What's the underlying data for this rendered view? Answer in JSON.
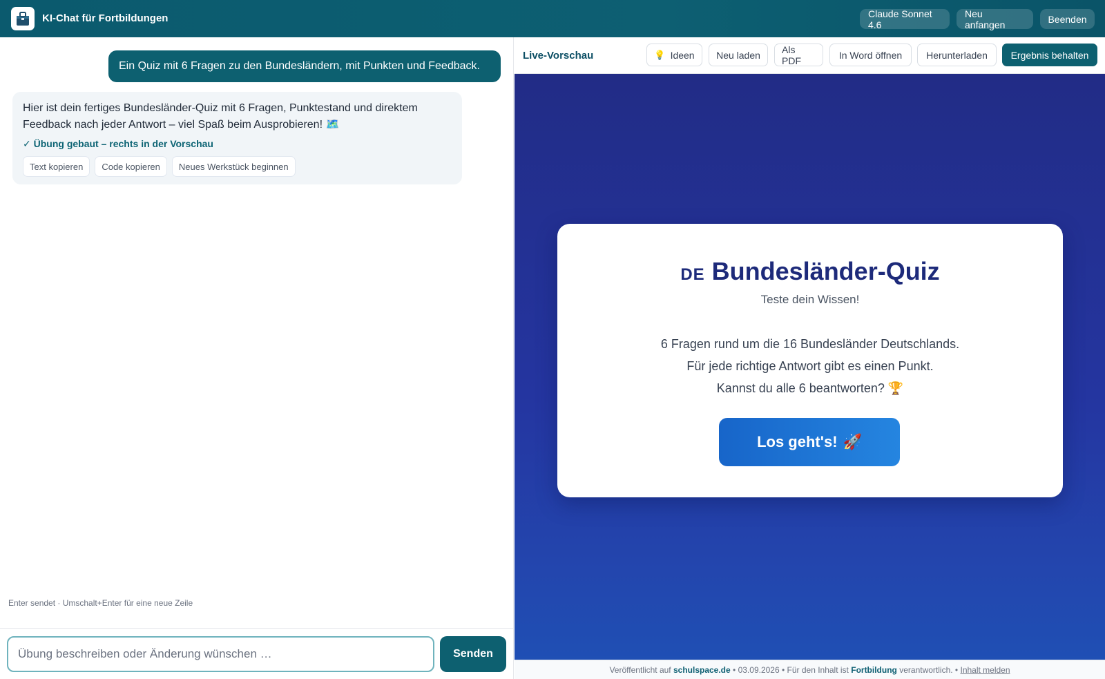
{
  "header": {
    "app_title": "KI-Chat für Fortbildungen",
    "logo_icon": "toolbox-icon",
    "buttons": {
      "model": "Claude Sonnet 4.6",
      "restart": "Neu anfangen",
      "quit": "Beenden"
    }
  },
  "chat": {
    "user_message": "Ein Quiz mit 6 Fragen zu den Bundesländern, mit Punkten und Feedback.",
    "assistant_message": "Hier ist dein fertiges Bundesländer-Quiz mit 6 Fragen, Punktestand und direktem Feedback nach jeder Antwort – viel Spaß beim Ausprobieren! 🗺️",
    "status": "✓ Übung gebaut – rechts in der Vorschau",
    "actions": {
      "copy_text": "Text kopieren",
      "copy_code": "Code kopieren",
      "new_piece": "Neues Werkstück beginnen"
    },
    "hint": "Enter sendet · Umschalt+Enter für eine neue Zeile",
    "input_placeholder": "Übung beschreiben oder Änderung wünschen …",
    "send_label": "Senden"
  },
  "preview": {
    "label": "Live-Vorschau",
    "toolbar": {
      "ideas_icon": "💡",
      "ideas": "Ideen",
      "reload": "Neu laden",
      "pdf": "Als PDF",
      "word": "In Word öffnen",
      "download": "Herunterladen",
      "keep": "Ergebnis behalten"
    },
    "quiz": {
      "flag": "DE",
      "title": "Bundesländer-Quiz",
      "subtitle": "Teste dein Wissen!",
      "line1": "6 Fragen rund um die 16 Bundesländer Deutschlands.",
      "line2": "Für jede richtige Antwort gibt es einen Punkt.",
      "line3": "Kannst du alle 6 beantworten? 🏆",
      "start": "Los geht's!",
      "start_icon": "🚀"
    },
    "footer": {
      "published_prefix": "Veröffentlicht auf",
      "site": "schulspace.de",
      "date": "• 03.09.2026 • Für den Inhalt ist",
      "owner": "Fortbildung",
      "suffix": "verantwortlich. •",
      "report": "Inhalt melden"
    }
  },
  "colors": {
    "header_bg": "#0d5f72",
    "accent": "#0d6070",
    "quiz_title": "#1d2a7a",
    "stage_bg": "#2435a0",
    "start_button": "#1e76d6"
  }
}
